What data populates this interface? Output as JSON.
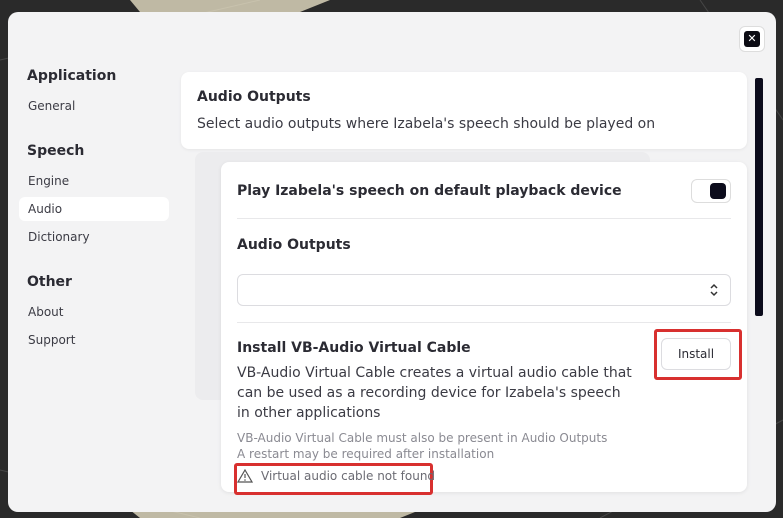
{
  "sidebar": {
    "groups": [
      {
        "title": "Application",
        "items": [
          {
            "label": "General"
          }
        ]
      },
      {
        "title": "Speech",
        "items": [
          {
            "label": "Engine"
          },
          {
            "label": "Audio"
          },
          {
            "label": "Dictionary"
          }
        ]
      },
      {
        "title": "Other",
        "items": [
          {
            "label": "About"
          },
          {
            "label": "Support"
          }
        ]
      }
    ],
    "active": "Audio"
  },
  "header": {
    "title": "Audio Outputs",
    "subtitle": "Select audio outputs where Izabela's speech should be played on"
  },
  "settings": {
    "default_device_label": "Play Izabela's speech on default playback device",
    "default_device_enabled": true,
    "audio_outputs_label": "Audio Outputs",
    "audio_outputs_value": "",
    "vb_title": "Install VB-Audio Virtual Cable",
    "vb_description": "VB-Audio Virtual Cable creates a virtual audio cable that can be used as a recording device for Izabela's speech in other applications",
    "vb_note_1": "VB-Audio Virtual Cable must also be present in Audio Outputs",
    "vb_note_2": "A restart may be required after installation",
    "install_label": "Install",
    "warning_text": "Virtual audio cable not found"
  },
  "close_icon": "close-icon",
  "colors": {
    "accent_dark": "#0c0c1c",
    "highlight_red": "#d8302f"
  }
}
